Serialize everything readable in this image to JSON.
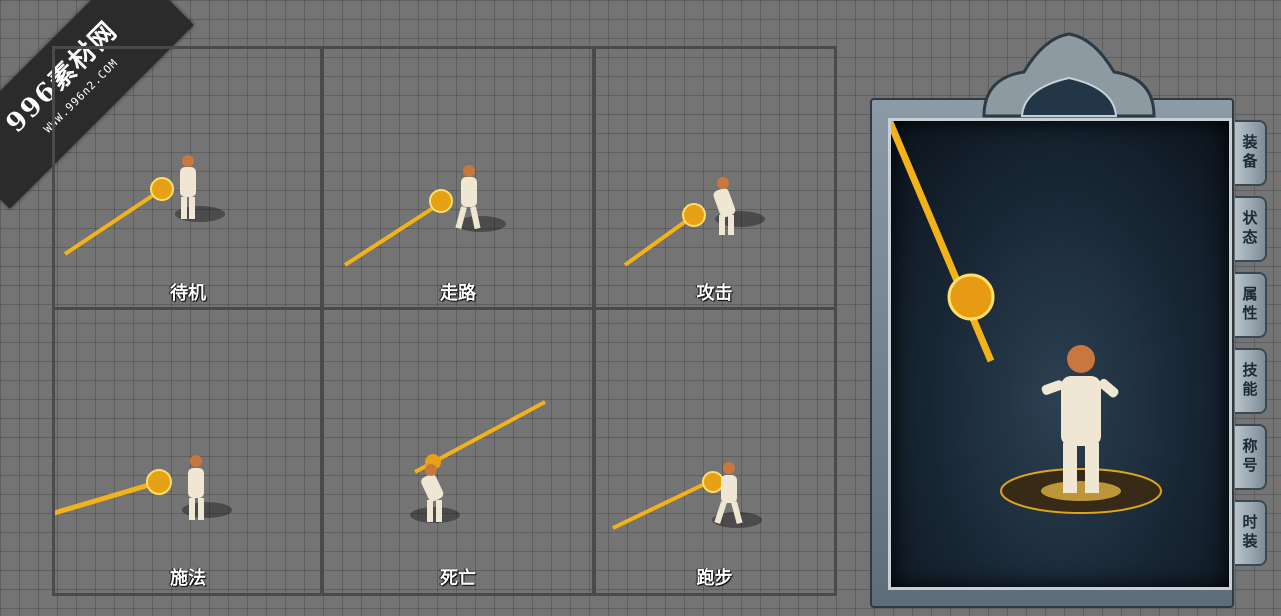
{
  "watermark": {
    "title": "996素材网",
    "url": "WWW.996n2.COM"
  },
  "animations": [
    {
      "label": "待机"
    },
    {
      "label": "走路"
    },
    {
      "label": "攻击"
    },
    {
      "label": "施法"
    },
    {
      "label": "死亡"
    },
    {
      "label": "跑步"
    }
  ],
  "side_tabs": [
    {
      "label": "装备"
    },
    {
      "label": "状态"
    },
    {
      "label": "属性"
    },
    {
      "label": "技能"
    },
    {
      "label": "称号"
    },
    {
      "label": "时装"
    }
  ],
  "colors": {
    "weapon_gold": "#f3b21a",
    "skin": "#c8773e",
    "outfit": "#efe6d4"
  }
}
